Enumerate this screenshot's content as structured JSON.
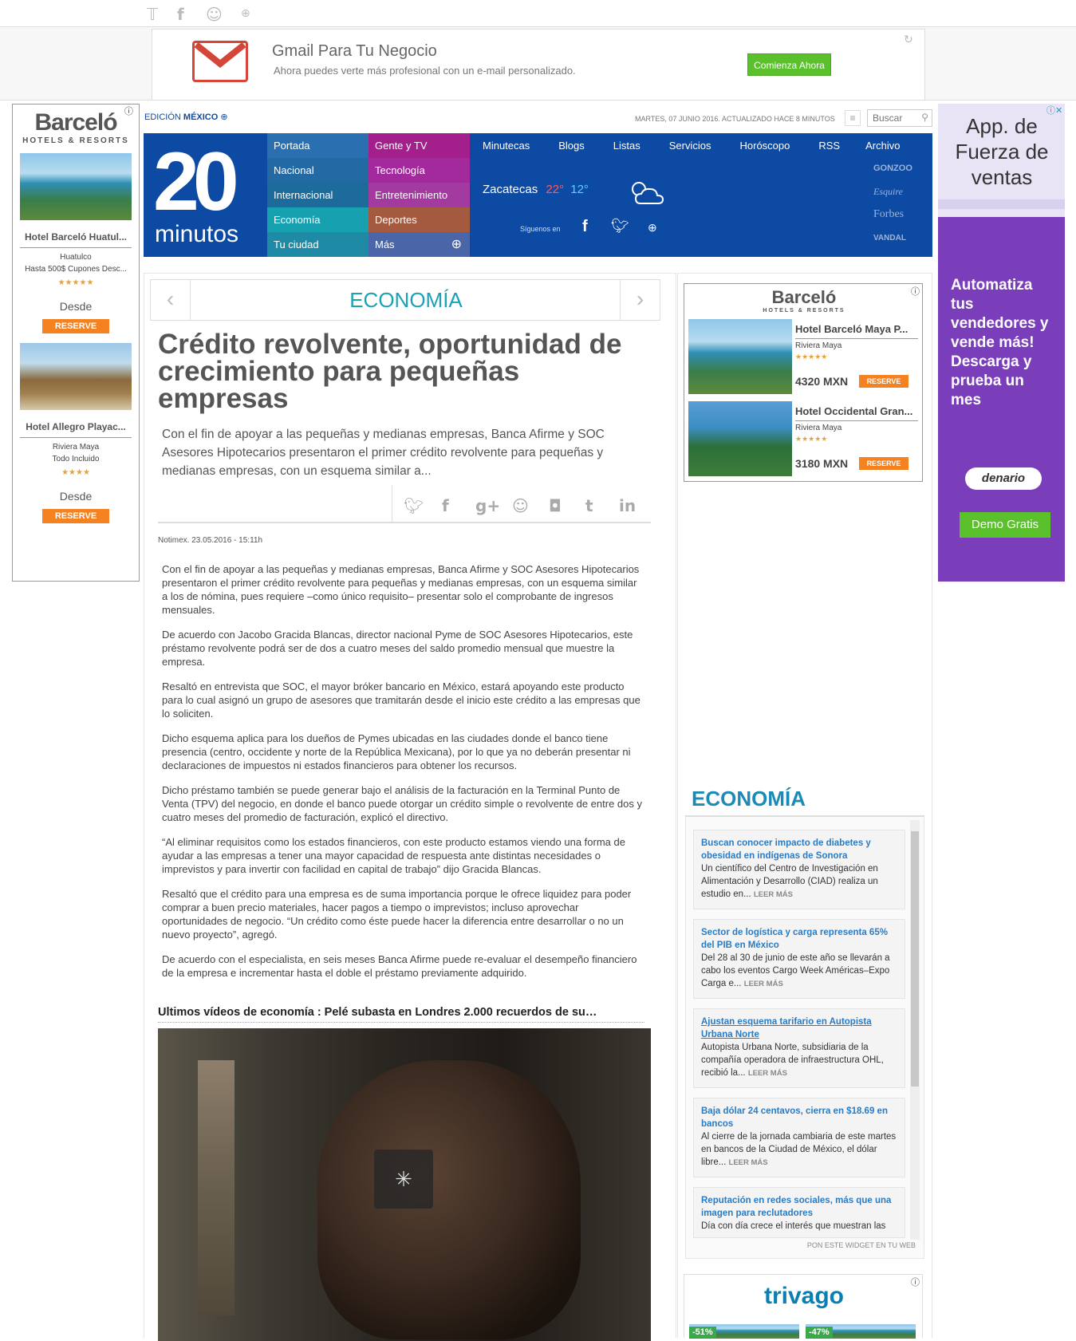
{
  "topbar": {
    "icons": [
      "twitter-icon",
      "facebook-icon",
      "meneame-icon",
      "plus-icon"
    ]
  },
  "gmail_ad": {
    "title": "Gmail Para Tu Negocio",
    "subtitle": "Ahora puedes verte más profesional con un e-mail personalizado.",
    "cta": "Comienza Ahora",
    "colors": {
      "cta": "#5ac12d",
      "logo_red": "#d44638"
    }
  },
  "left_ad": {
    "brand": "Barceló",
    "brand_sub": "HOTELS & RESORTS",
    "hotels": [
      {
        "name": "Hotel Barceló Huatul...",
        "location": "Huatulco",
        "extra": "Hasta 500$ Cupones Desc...",
        "stars": "★★★★★",
        "from": "Desde",
        "cta": "RESERVE"
      },
      {
        "name": "Hotel Allegro Playac...",
        "location": "Riviera Maya",
        "extra": "Todo Incluido",
        "stars": "★★★★",
        "from": "Desde",
        "cta": "RESERVE"
      }
    ]
  },
  "right_ad": {
    "headline": "App. de Fuerza de ventas",
    "body": "Automatiza tus vendedores y vende más! Descarga y prueba un mes",
    "brand": "denario",
    "cta": "Demo Gratis",
    "colors": {
      "bg": "#7a3eba",
      "cta": "#5ac12d"
    }
  },
  "edition": {
    "label": "EDICIÓN",
    "country": "MÉXICO",
    "date": "MARTES, 07 JUNIO 2016. ACTUALIZADO HACE 8 MINUTOS",
    "search_placeholder": "Buscar"
  },
  "logo": {
    "number": "20",
    "word": "minutos"
  },
  "nav": {
    "col1": [
      "Portada",
      "Nacional",
      "Internacional",
      "Economía",
      "Tu ciudad"
    ],
    "col2": [
      "Gente y TV",
      "Tecnología",
      "Entretenimiento",
      "Deportes",
      "Más"
    ],
    "top": [
      "Minutecas",
      "Blogs",
      "Listas",
      "Servicios",
      "Horóscopo",
      "RSS",
      "Archivo"
    ],
    "partners": [
      "GONZOO",
      "Esquire",
      "Forbes",
      "VANDAL"
    ],
    "follow": "Síguenos en"
  },
  "weather": {
    "city": "Zacatecas",
    "high": "22°",
    "low": "12°"
  },
  "article": {
    "section": "ECONOMÍA",
    "title": "Crédito revolvente, oportunidad de crecimiento para pequeñas empresas",
    "lead": "Con el fin de apoyar a las pequeñas y medianas empresas, Banca Afirme y SOC Asesores Hipotecarios presentaron el primer crédito revolvente para pequeñas y medianas empresas, con un esquema similar a...",
    "byline": "Notimex. 23.05.2016 - 15:11h",
    "paragraphs": [
      "Con el fin de apoyar a las pequeñas y medianas empresas, Banca Afirme y SOC Asesores Hipotecarios presentaron el primer crédito revolvente para pequeñas y medianas empresas, con un esquema similar a los de nómina, pues requiere –como único requisito– presentar solo el comprobante de ingresos mensuales.",
      "De acuerdo con Jacobo Gracida Blancas, director nacional Pyme de SOC Asesores Hipotecarios, este préstamo revolvente podrá ser de dos a cuatro meses del saldo promedio mensual que muestre la empresa.",
      "Resaltó en entrevista que SOC, el mayor bróker bancario en México, estará apoyando este producto para lo cual asignó un grupo de asesores que tramitarán desde el inicio este crédito a las empresas que lo soliciten.",
      "Dicho esquema aplica para los dueños de Pymes ubicadas en las ciudades donde el banco tiene presencia (centro, occidente y norte de la República Mexicana), por lo que ya no deberán presentar ni declaraciones de impuestos ni estados financieros para obtener los recursos.",
      "Dicho préstamo también se puede generar bajo el análisis de la facturación en la Terminal Punto de Venta (TPV) del negocio, en donde el banco puede otorgar un crédito simple o revolvente de entre dos y cuatro meses del promedio de facturación, explicó el directivo.",
      "“Al eliminar requisitos como los estados financieros, con este producto estamos viendo una forma de ayudar a las empresas a tener una mayor capacidad de respuesta ante distintas necesidades o imprevistos y para invertir con facilidad en capital de trabajo” dijo Gracida Blancas.",
      "Resaltó que el crédito para una empresa es de suma importancia porque le ofrece liquidez para poder comprar a buen precio materiales, hacer pagos a tiempo o imprevistos; incluso aprovechar oportunidades de negocio. “Un crédito como éste puede hacer la diferencia entre desarrollar o no un nuevo proyecto”, agregó.",
      "De acuerdo con el especialista, en seis meses Banca Afirme puede re-evaluar el desempeño financiero de la empresa e incrementar hasta el doble el préstamo previamente adquirido."
    ],
    "video_title": "Ultimos vídeos de economía : Pelé subasta en Londres 2.000 recuerdos de su…"
  },
  "side_ad": {
    "brand": "Barceló",
    "brand_sub": "HOTELS & RESORTS",
    "hotels": [
      {
        "name": "Hotel Barceló Maya P...",
        "location": "Riviera Maya",
        "stars": "★★★★★",
        "price": "4320 MXN",
        "cta": "RESERVE"
      },
      {
        "name": "Hotel Occidental Gran...",
        "location": "Riviera Maya",
        "stars": "★★★★★",
        "price": "3180 MXN",
        "cta": "RESERVE"
      }
    ]
  },
  "widget": {
    "title": "ECONOMÍA",
    "footer": "PON ESTE WIDGET EN TU WEB",
    "more": "LEER MÁS",
    "items": [
      {
        "title": "Buscan conocer impacto de diabetes y obesidad en indígenas de Sonora",
        "desc": "Un científico del Centro de Investigación en Alimentación y Desarrollo (CIAD) realiza un estudio en..."
      },
      {
        "title": "Sector de logística y carga representa 65% del PIB en México",
        "desc": "Del 28 al 30 de junio de este año se llevarán a cabo los eventos Cargo Week Américas–Expo Carga e..."
      },
      {
        "title": "Ajustan esquema tarifario en Autopista Urbana Norte",
        "desc": "Autopista Urbana Norte, subsidiaria de la compañía operadora de infraestructura OHL, recibió la..."
      },
      {
        "title": "Baja dólar 24 centavos, cierra en $18.69 en bancos",
        "desc": "Al cierre de la jornada cambiaria de este martes en bancos de la Ciudad de México, el dólar libre..."
      },
      {
        "title": "Reputación en redes sociales, más que una imagen para reclutadores",
        "desc": "Día con día crece el interés que muestran las"
      }
    ]
  },
  "trivago": {
    "brand": "trivago",
    "deals": [
      "-51%",
      "-47%"
    ]
  }
}
